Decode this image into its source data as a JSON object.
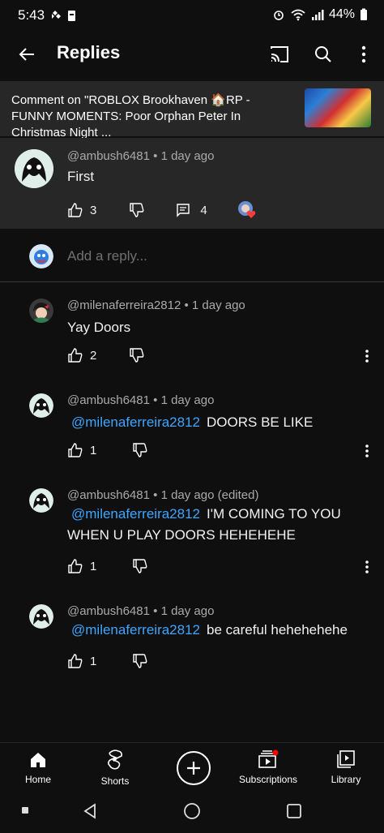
{
  "status": {
    "time": "5:43",
    "battery": "44%"
  },
  "appbar": {
    "title": "Replies"
  },
  "context": {
    "text": "Comment on \"ROBLOX Brookhaven 🏠RP - FUNNY MOMENTS: Poor Orphan Peter In Christmas Night ..."
  },
  "main_comment": {
    "author": "@ambush6481",
    "time": "1 day ago",
    "text": "First",
    "likes": "3",
    "replies": "4"
  },
  "reply_input": {
    "placeholder": "Add a reply..."
  },
  "replies": [
    {
      "author": "@milenaferreira2812",
      "time": "1 day ago",
      "mention": "",
      "text": "Yay Doors",
      "likes": "2"
    },
    {
      "author": "@ambush6481",
      "time": "1 day ago",
      "mention": "@milenaferreira2812",
      "text": "DOORS BE LIKE",
      "likes": "1"
    },
    {
      "author": "@ambush6481",
      "time": "1 day ago (edited)",
      "mention": "@milenaferreira2812",
      "text": "I'M COMING TO YOU WHEN U PLAY DOORS HEHEHEHE",
      "likes": "1"
    },
    {
      "author": "@ambush6481",
      "time": "1 day ago",
      "mention": "@milenaferreira2812",
      "text": "be careful hehehehehe",
      "likes": "1"
    }
  ],
  "nav": {
    "home": "Home",
    "shorts": "Shorts",
    "subscriptions": "Subscriptions",
    "library": "Library"
  },
  "colors": {
    "background": "#0f0f0f",
    "card": "#272727",
    "link": "#3ea6ff",
    "meta": "#aaaaaa"
  }
}
